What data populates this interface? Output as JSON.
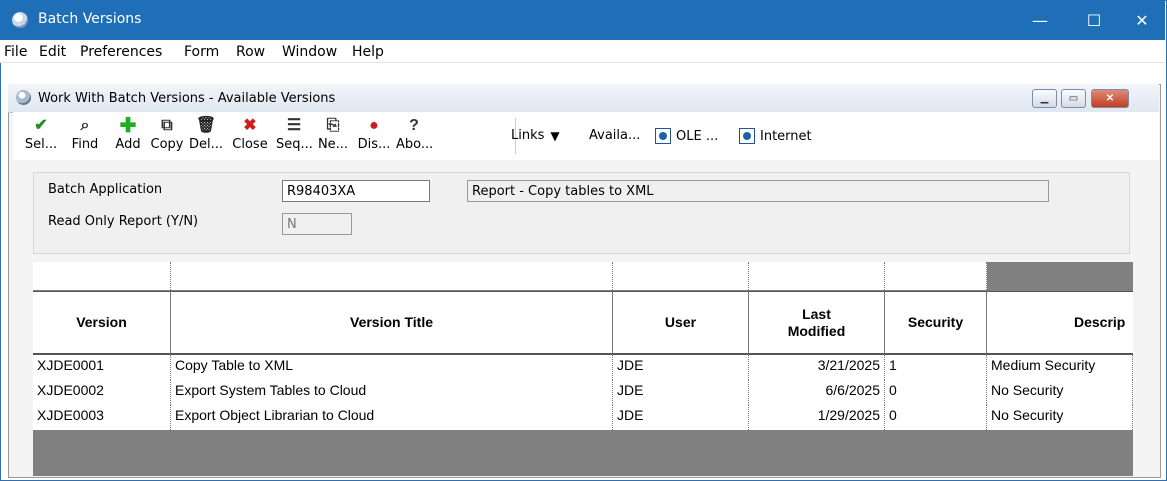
{
  "window": {
    "title": "Batch Versions",
    "controls": {
      "minimize": "—",
      "maximize": "☐",
      "close": "✕"
    }
  },
  "menu": [
    "File",
    "Edit",
    "Preferences",
    "Form",
    "Row",
    "Window",
    "Help"
  ],
  "child_window": {
    "title": "Work With Batch Versions - Available Versions"
  },
  "toolbar": {
    "buttons": [
      {
        "label": "Sel...",
        "icon": "check-icon"
      },
      {
        "label": "Find",
        "icon": "find-icon"
      },
      {
        "label": "Add",
        "icon": "add-icon"
      },
      {
        "label": "Copy",
        "icon": "copy-icon"
      },
      {
        "label": "Del...",
        "icon": "trash-icon"
      },
      {
        "label": "Close",
        "icon": "close-icon"
      },
      {
        "label": "Seq...",
        "icon": "sequence-icon"
      },
      {
        "label": "Ne...",
        "icon": "new-icon"
      },
      {
        "label": "Dis...",
        "icon": "display-icon"
      },
      {
        "label": "Abo...",
        "icon": "about-icon"
      }
    ],
    "links": {
      "links_label": "Links",
      "available_label": "Availa...",
      "ole_label": "OLE ...",
      "internet_label": "Internet"
    }
  },
  "form": {
    "batch_application_label": "Batch Application",
    "batch_application_value": "R98403XA",
    "batch_application_desc": "Report - Copy tables to XML",
    "read_only_label": "Read Only Report (Y/N)",
    "read_only_value": "N"
  },
  "grid": {
    "headers": [
      "Version",
      "Version Title",
      "User",
      "Last Modified",
      "Security",
      "Descrip"
    ],
    "rows": [
      [
        "XJDE0001",
        "Copy Table to XML",
        "JDE",
        "3/21/2025",
        "1",
        "Medium Security"
      ],
      [
        "XJDE0002",
        "Export System Tables to Cloud",
        "JDE",
        "6/6/2025",
        "0",
        "No Security"
      ],
      [
        "XJDE0003",
        "Export Object Librarian to Cloud",
        "JDE",
        "1/29/2025",
        "0",
        "No Security"
      ]
    ]
  },
  "colors": {
    "titlebar": "#1f6fb8",
    "grid_empty": "#808080"
  }
}
